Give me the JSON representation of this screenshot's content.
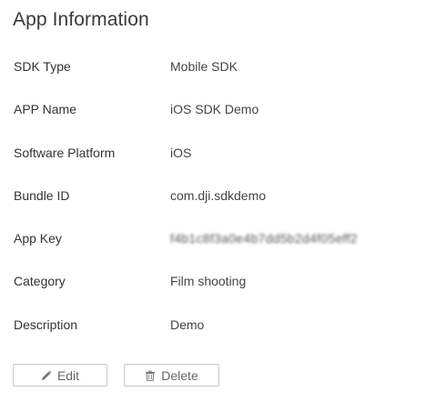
{
  "page": {
    "title": "App Information"
  },
  "fields": [
    {
      "label": "SDK Type",
      "value": "Mobile SDK"
    },
    {
      "label": "APP Name",
      "value": "iOS SDK Demo"
    },
    {
      "label": "Software Platform",
      "value": "iOS"
    },
    {
      "label": "Bundle ID",
      "value": "com.dji.sdkdemo"
    },
    {
      "label": "App Key",
      "value": "f4b1c8f3a0e4b7dd5b2d4f05eff2"
    },
    {
      "label": "Category",
      "value": "Film shooting"
    },
    {
      "label": "Description",
      "value": "Demo"
    }
  ],
  "actions": {
    "edit_label": "Edit",
    "delete_label": "Delete",
    "edit_icon": "pencil-icon",
    "delete_icon": "trash-icon"
  },
  "colors": {
    "text": "#333333",
    "button_border": "#c8c8c8",
    "button_text": "#666666"
  }
}
